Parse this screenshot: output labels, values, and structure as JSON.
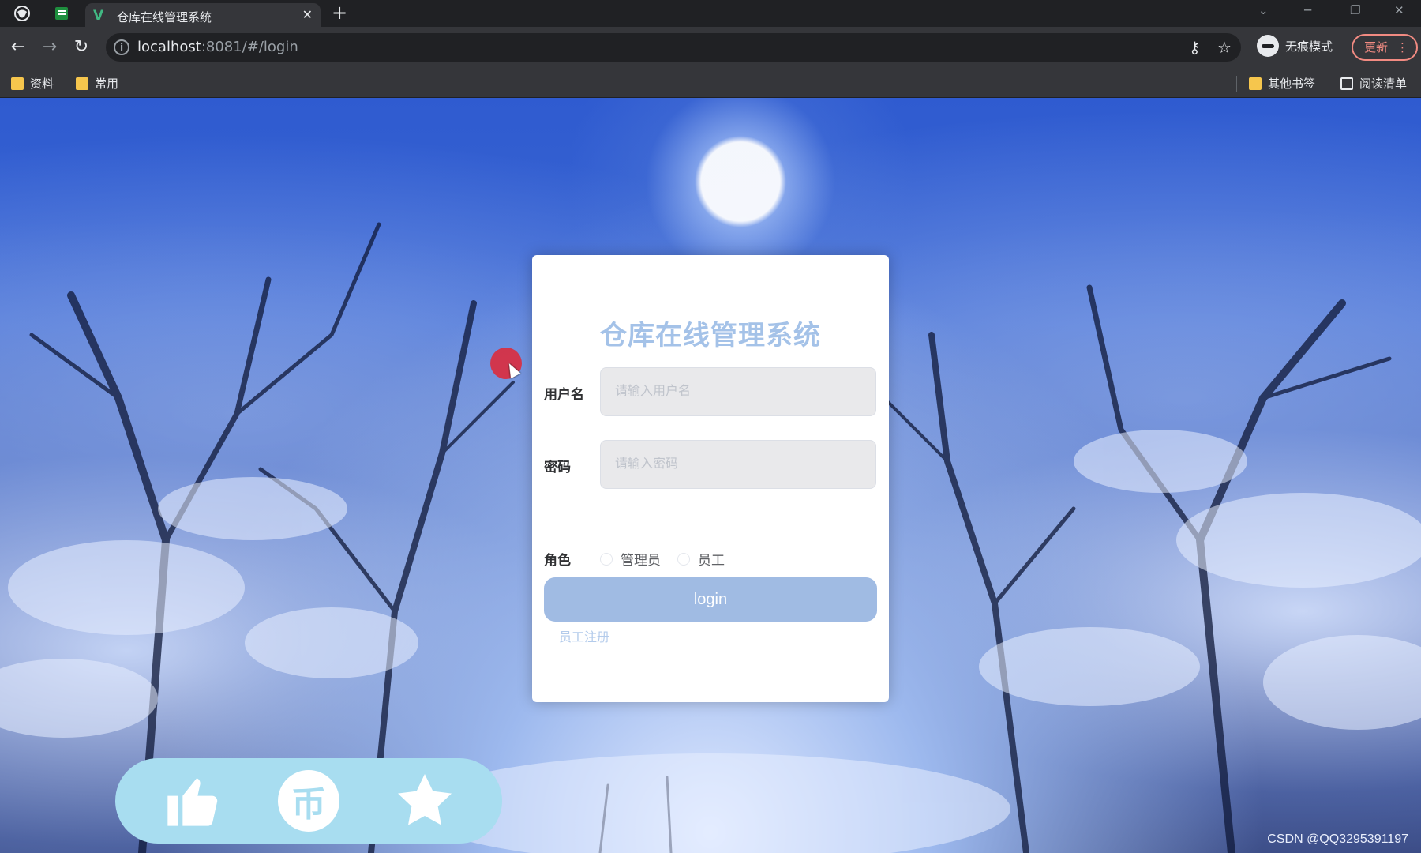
{
  "browser": {
    "tab": {
      "title": "仓库在线管理系统",
      "close": "✕"
    },
    "new_tab": "+",
    "window_controls": {
      "list": "⌄",
      "minimize": "─",
      "restore": "❐",
      "close": "✕"
    },
    "address": {
      "host": "localhost",
      "rest": ":8081/#/login"
    },
    "incognito_label": "无痕模式",
    "update_label": "更新",
    "menu": "⋮",
    "bookmarks": [
      {
        "label": "资料"
      },
      {
        "label": "常用"
      }
    ],
    "other_bookmarks": "其他书签",
    "reading_list": "阅读清单"
  },
  "login": {
    "title": "仓库在线管理系统",
    "username": {
      "label": "用户名",
      "placeholder": "请输入用户名"
    },
    "password": {
      "label": "密码",
      "placeholder": "请输入密码"
    },
    "role": {
      "label": "角色",
      "options": [
        "管理员",
        "员工"
      ]
    },
    "submit_label": "login",
    "register_label": "员工注册"
  },
  "overlay": {
    "watermark": "CSDN @QQ3295391197",
    "actions": [
      "like-icon",
      "coin-icon",
      "favorite-icon"
    ],
    "coin_glyph": "币"
  },
  "colors": {
    "title": "#a4c2e8",
    "button": "#a0bbe3",
    "link": "#b3cbeb",
    "pill": "#a8ddf0"
  }
}
